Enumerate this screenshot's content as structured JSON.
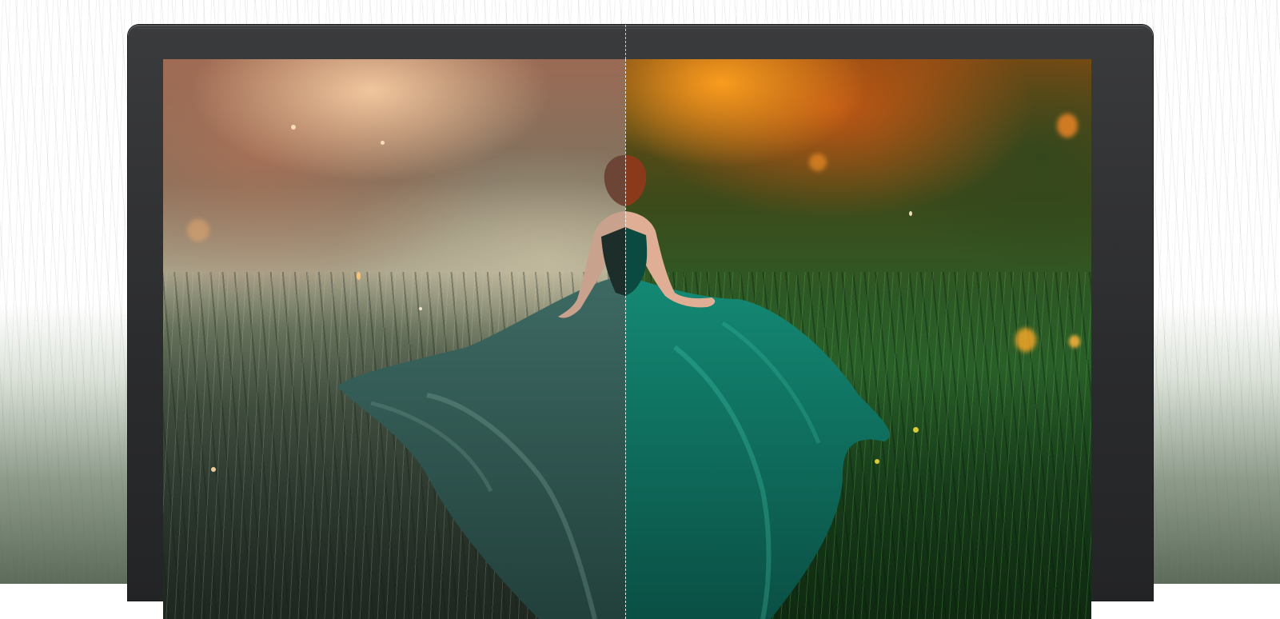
{
  "scene": {
    "description_label": "",
    "colors": {
      "bezel": "#2a2b2d",
      "dress_left": "#2f5a54",
      "dress_right": "#0f6a5c",
      "hair": "#7a3518",
      "divider": "#ffffff"
    },
    "icons": [
      "monitor-frame",
      "comparison-divider",
      "woman-in-gown"
    ]
  }
}
